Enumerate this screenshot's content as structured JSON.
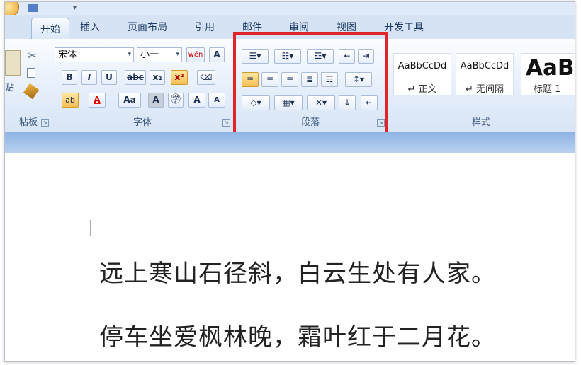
{
  "tabs": [
    "开始",
    "插入",
    "页面布局",
    "引用",
    "邮件",
    "审阅",
    "视图",
    "开发工具"
  ],
  "clipboard": {
    "paste_label": "贴",
    "group_label": "粘板"
  },
  "font": {
    "name": "宋体",
    "size": "小一",
    "group_label": "字体",
    "bold": "B",
    "italic": "I",
    "underline": "U",
    "strike": "abc",
    "subscript": "x₂",
    "superscript": "x²",
    "changecase": "Aa",
    "grow": "A",
    "shrink": "A",
    "clear": "A",
    "phonetic": "wén",
    "charborder": "A",
    "font_color": "A",
    "highlight": "ab"
  },
  "paragraph": {
    "group_label": "段落"
  },
  "styles": {
    "group_label": "样式",
    "items": [
      {
        "sample": "AaBbCcDd",
        "caption": "↵ 正文"
      },
      {
        "sample": "AaBbCcDd",
        "caption": "↵ 无间隔"
      },
      {
        "sample": "AaBb",
        "caption": "标题 1"
      }
    ]
  },
  "document": {
    "lines": [
      "远上寒山石径斜，白云生处有人家。",
      "停车坐爱枫林晚，霜叶红于二月花。"
    ]
  },
  "annotation_color": "#e0242c"
}
